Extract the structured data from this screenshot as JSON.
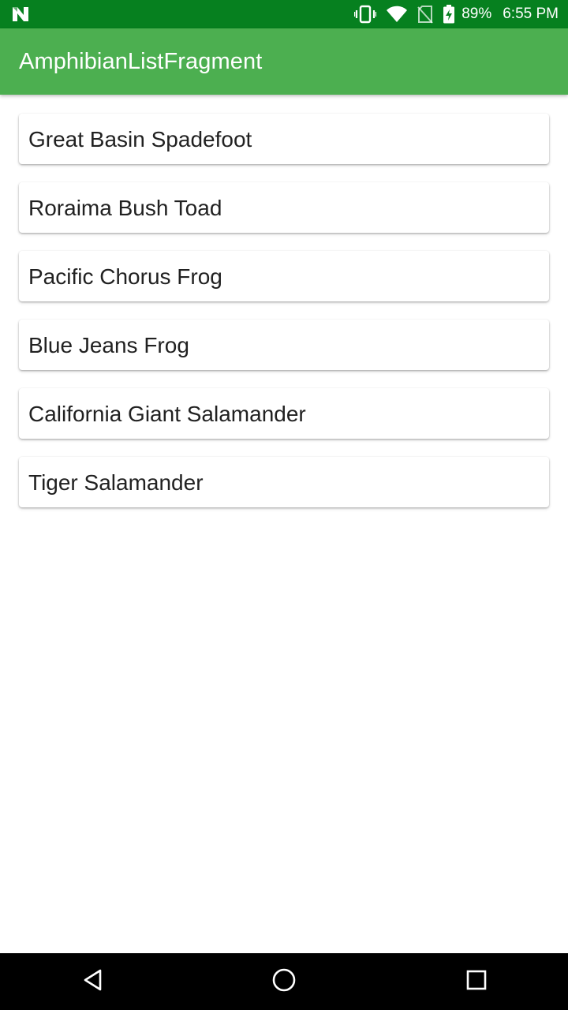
{
  "status_bar": {
    "battery_percent": "89%",
    "time": "6:55 PM",
    "icons": [
      "notification-n-icon",
      "vibrate-icon",
      "wifi-icon",
      "no-sim-icon",
      "battery-charging-icon"
    ]
  },
  "app_bar": {
    "title": "AmphibianListFragment"
  },
  "amphibians": [
    "Great Basin Spadefoot",
    "Roraima Bush Toad",
    "Pacific Chorus Frog",
    "Blue Jeans Frog",
    "California Giant Salamander",
    "Tiger Salamander"
  ],
  "nav_bar": {
    "buttons": [
      "back-icon",
      "home-icon",
      "recents-icon"
    ]
  },
  "colors": {
    "status_bar": "#06801f",
    "app_bar": "#4caf50",
    "nav_bar": "#000000",
    "card_text": "#212121"
  }
}
